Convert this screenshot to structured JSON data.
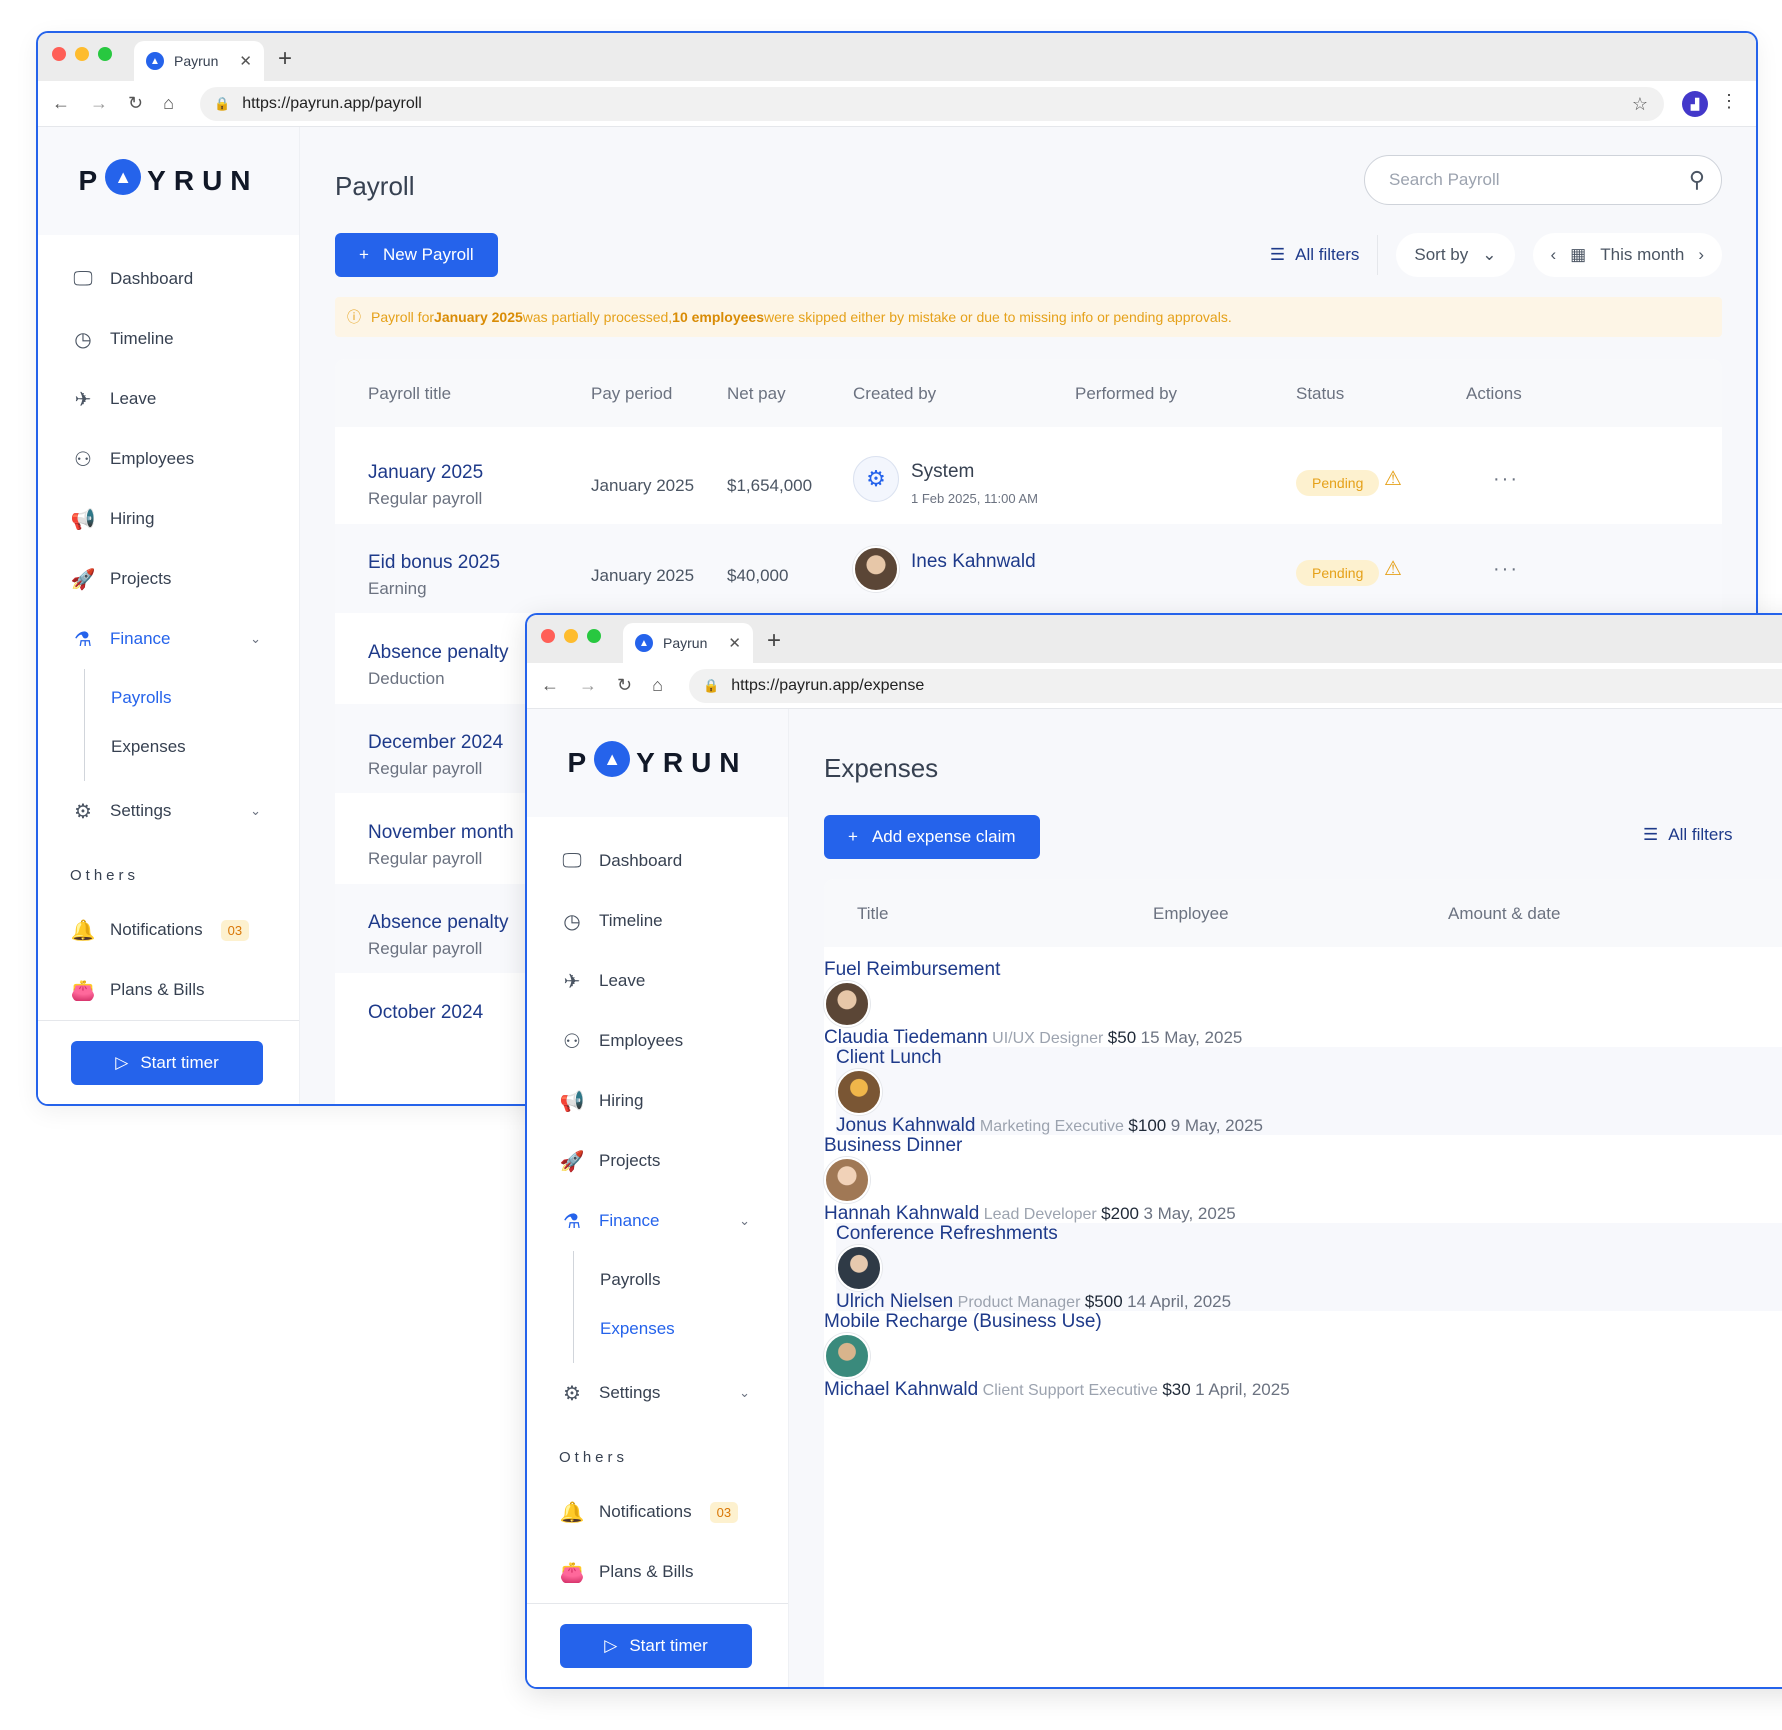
{
  "windows": {
    "payroll": {
      "tab_title": "Payrun",
      "url": "https://payrun.app/payroll",
      "page_title": "Payroll",
      "search_placeholder": "Search Payroll",
      "new_button": "New Payroll",
      "all_filters": "All filters",
      "sort_by": "Sort by",
      "date_range": "This month",
      "alert": {
        "p1": "Payroll for ",
        "b1": "January 2025",
        "p2": " was partially processed, ",
        "b2": "10 employees",
        "p3": " were skipped either by mistake or due to missing info or pending approvals."
      },
      "columns": [
        "Payroll title",
        "Pay period",
        "Net pay",
        "Created by",
        "Performed by",
        "Status",
        "Actions"
      ],
      "rows": [
        {
          "title": "January 2025",
          "type": "Regular payroll",
          "period": "January 2025",
          "net": "$1,654,000",
          "creator": "System",
          "created_at": "1 Feb 2025, 11:00 AM",
          "status": "Pending"
        },
        {
          "title": "Eid bonus 2025",
          "type": "Earning",
          "period": "January 2025",
          "net": "$40,000",
          "creator": "Ines Kahnwald",
          "status": "Pending"
        },
        {
          "title": "Absence penalty",
          "type": "Deduction"
        },
        {
          "title": "December 2024",
          "type": "Regular payroll"
        },
        {
          "title": "November month",
          "type": "Regular payroll"
        },
        {
          "title": "Absence penalty",
          "type": "Regular payroll"
        },
        {
          "title": "October 2024",
          "type": ""
        }
      ]
    },
    "expense": {
      "tab_title": "Payrun",
      "url": "https://payrun.app/expense",
      "page_title": "Expenses",
      "add_button": "Add expense claim",
      "all_filters": "All filters",
      "columns": [
        "Title",
        "Employee",
        "Amount & date"
      ],
      "rows": [
        {
          "title": "Fuel Reimbursement",
          "name": "Claudia Tiedemann",
          "role": "UI/UX Designer",
          "amount": "$50",
          "date": "15 May, 2025"
        },
        {
          "title": "Client Lunch",
          "name": "Jonus Kahnwald",
          "role": "Marketing Executive",
          "amount": "$100",
          "date": "9 May, 2025"
        },
        {
          "title": "Business Dinner",
          "name": "Hannah Kahnwald",
          "role": "Lead Developer",
          "amount": "$200",
          "date": "3 May, 2025"
        },
        {
          "title": "Conference Refreshments",
          "name": "Ulrich Nielsen",
          "role": "Product Manager",
          "amount": "$500",
          "date": "14 April, 2025"
        },
        {
          "title": "Mobile Recharge (Business Use)",
          "name": "Michael Kahnwald",
          "role": "Client Support Executive",
          "amount": "$30",
          "date": "1 April, 2025"
        }
      ]
    }
  },
  "sidebar": {
    "logo": {
      "left": "P",
      "right": "YRUN"
    },
    "items": [
      "Dashboard",
      "Timeline",
      "Leave",
      "Employees",
      "Hiring",
      "Projects",
      "Finance"
    ],
    "finance_sub": [
      "Payrolls",
      "Expenses"
    ],
    "settings": "Settings",
    "others_label": "Others",
    "notifications": "Notifications",
    "notifications_count": "03",
    "plans": "Plans & Bills",
    "start_timer": "Start timer"
  },
  "icons": {
    "dashboard": "monitor-icon",
    "timeline": "clock-icon",
    "leave": "plane-icon",
    "employees": "users-icon",
    "hiring": "megaphone-icon",
    "projects": "rocket-icon",
    "finance": "flask-icon",
    "settings": "gear-icon",
    "notifications": "bell-icon",
    "plans": "wallet-icon"
  },
  "colors": {
    "accent": "#2563eb",
    "title": "#1e3a8a",
    "pending": "#e5a11a",
    "alert_bg": "#fdf5e6"
  }
}
